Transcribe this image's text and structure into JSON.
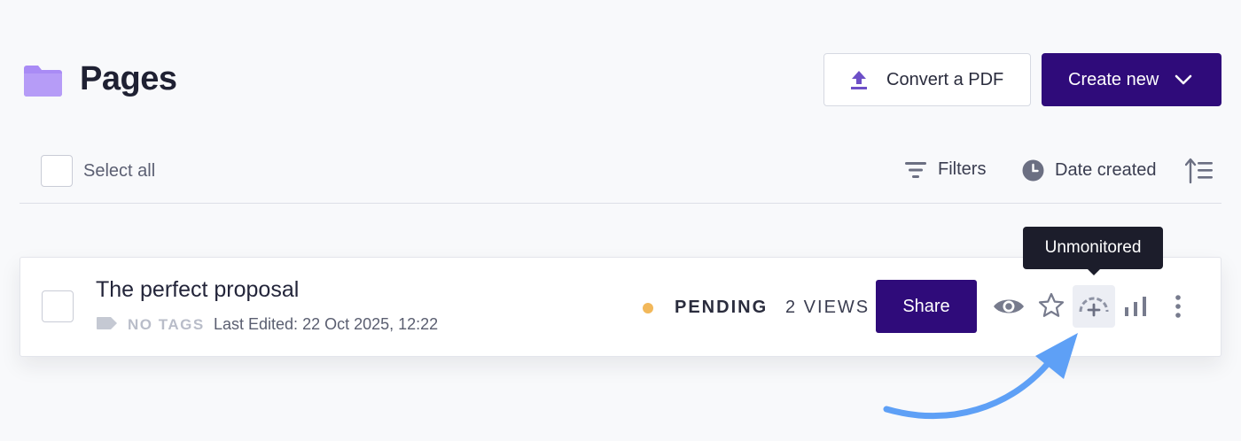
{
  "header": {
    "title": "Pages",
    "folder_icon": "folder-icon",
    "convert_label": "Convert a PDF",
    "create_label": "Create new"
  },
  "toolbar": {
    "select_all_label": "Select all",
    "filters_label": "Filters",
    "sort_label": "Date created"
  },
  "row": {
    "title": "The perfect proposal",
    "tags_label": "NO TAGS",
    "last_edited": "Last Edited: 22 Oct 2025, 12:22",
    "status": "PENDING",
    "status_color": "#f2b85a",
    "views": "2 VIEWS",
    "share_label": "Share",
    "actions": [
      "eye-icon",
      "star-icon",
      "monitor-icon",
      "stats-icon",
      "more-icon"
    ]
  },
  "tooltip": {
    "text": "Unmonitored"
  },
  "colors": {
    "brand": "#2f0b7a",
    "folder": "#a98bf5",
    "arrow": "#5ea0f6"
  }
}
